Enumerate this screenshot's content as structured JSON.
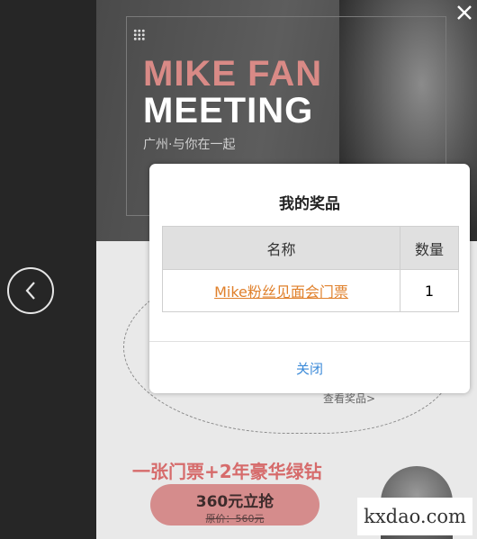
{
  "banner": {
    "title_line1": "MIKE FAN",
    "title_line2": "MEETING",
    "subtitle": "广州·与你在一起"
  },
  "background_page": {
    "view_prize_link": "查看奖品>",
    "promo_text": "一张门票+2年豪华绿钻",
    "buy_price": "360元立抢",
    "original_price": "原价：560元"
  },
  "modal": {
    "title": "我的奖品",
    "table": {
      "headers": [
        "名称",
        "数量"
      ],
      "rows": [
        {
          "name": "Mike粉丝见面会门票",
          "quantity": "1"
        }
      ]
    },
    "close_label": "关闭"
  },
  "watermark": "kxdao.com",
  "icons": {
    "prev": "chevron-left-icon",
    "close": "close-icon"
  },
  "colors": {
    "title_accent": "#d98a86",
    "prize_link": "#e0802b",
    "close_link": "#3b8ad8",
    "buy_button": "#d58c8c"
  }
}
